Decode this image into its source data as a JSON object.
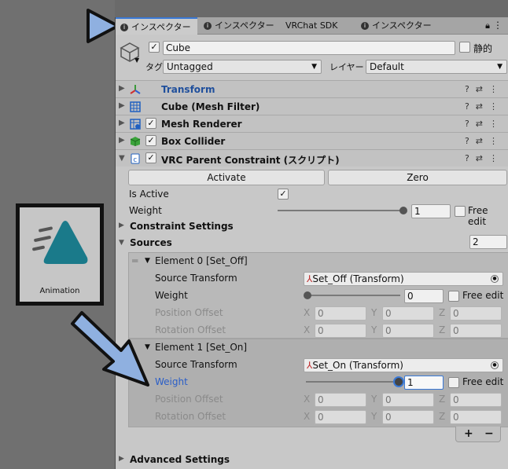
{
  "tabs": [
    {
      "label": "インスペクター",
      "icon": "info-icon"
    },
    {
      "label": "インスペクター",
      "icon": "info-icon"
    },
    {
      "label": "VRChat SDK",
      "icon": ""
    },
    {
      "label": "インスペクター",
      "icon": "info-icon"
    }
  ],
  "object": {
    "name": "Cube",
    "static_label": "静的",
    "tag_label": "タグ",
    "tag_value": "Untagged",
    "layer_label": "レイヤー",
    "layer_value": "Default"
  },
  "components": [
    {
      "name": "Transform",
      "icon": "transform-axes-icon",
      "color": "#1f4f9c"
    },
    {
      "name": "Cube (Mesh Filter)",
      "icon": "mesh-filter-grid-icon",
      "color": "#111111"
    },
    {
      "name": "Mesh Renderer",
      "icon": "mesh-renderer-icon",
      "color": "#111111"
    },
    {
      "name": "Box Collider",
      "icon": "box-collider-icon",
      "color": "#111111"
    },
    {
      "name": "VRC Parent Constraint (スクリプト)",
      "icon": "script-icon",
      "color": "#111111"
    }
  ],
  "constraint": {
    "activate_label": "Activate",
    "zero_label": "Zero",
    "is_active_label": "Is Active",
    "weight_label": "Weight",
    "weight_value": "1",
    "free_edit_label": "Free edit",
    "constraint_settings_label": "Constraint Settings",
    "sources_label": "Sources",
    "sources_count": "2",
    "advanced_label": "Advanced Settings"
  },
  "elements": [
    {
      "header": "Element 0 [Set_Off]",
      "source_label": "Source Transform",
      "source_value": "Set_Off (Transform)",
      "weight_label": "Weight",
      "weight_value": "0",
      "weight_fraction": 0,
      "free_edit": "Free edit",
      "pos_label": "Position Offset",
      "rot_label": "Rotation Offset",
      "x": "0",
      "y": "0",
      "z": "0"
    },
    {
      "header": "Element 1 [Set_On]",
      "source_label": "Source Transform",
      "source_value": "Set_On (Transform)",
      "weight_label": "Weight",
      "weight_value": "1",
      "weight_fraction": 1,
      "free_edit": "Free edit",
      "pos_label": "Position Offset",
      "rot_label": "Rotation Offset",
      "x": "0",
      "y": "0",
      "z": "0"
    }
  ],
  "axis": {
    "x": "X",
    "y": "Y",
    "z": "Z"
  },
  "animation_card": {
    "label": "Animation"
  },
  "list_buttons": {
    "plus": "+",
    "minus": "−"
  },
  "colors": {
    "accent": "#3a79d6",
    "arrow": "#8fb0e0",
    "anim_teal": "#1a7a8a"
  }
}
